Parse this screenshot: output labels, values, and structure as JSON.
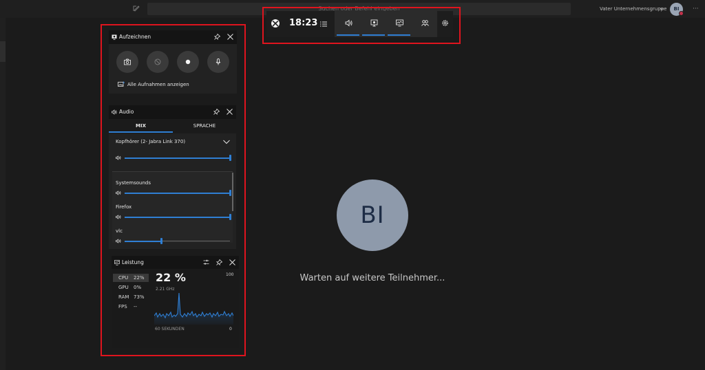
{
  "teams": {
    "search_placeholder": "Suchen oder Befehl eingeben",
    "org_name": "Vater Unternehmensgruppe",
    "avatar_initials": "BI",
    "big_avatar_initials": "BI",
    "waiting_text": "Warten auf weitere Teilnehmer..."
  },
  "gamebar": {
    "time": "18:23",
    "buttons": [
      "audio-widget",
      "capture-widget",
      "performance-widget",
      "social-widget"
    ]
  },
  "capture": {
    "title": "Aufzeichnen",
    "show_all": "Alle Aufnahmen anzeigen"
  },
  "audio": {
    "title": "Audio",
    "tabs": [
      {
        "label": "MIX",
        "active": true
      },
      {
        "label": "SPRACHE",
        "active": false
      }
    ],
    "device": "Kopfhörer (2- Jabra Link 370)",
    "master_volume": 1.0,
    "apps": [
      {
        "name": "Systemsounds",
        "volume": 1.0
      },
      {
        "name": "Firefox",
        "volume": 1.0
      },
      {
        "name": "vlc",
        "volume": 0.35
      }
    ]
  },
  "performance": {
    "title": "Leistung",
    "stats": [
      {
        "label": "CPU",
        "value": "22%"
      },
      {
        "label": "GPU",
        "value": "0%"
      },
      {
        "label": "RAM",
        "value": "73%"
      },
      {
        "label": "FPS",
        "value": "--"
      }
    ],
    "big_value": "22 %",
    "frequency": "2.21 GHz",
    "max": "100",
    "min": "0",
    "window": "60 SEKUNDEN",
    "accent": "#2f7fd4"
  }
}
